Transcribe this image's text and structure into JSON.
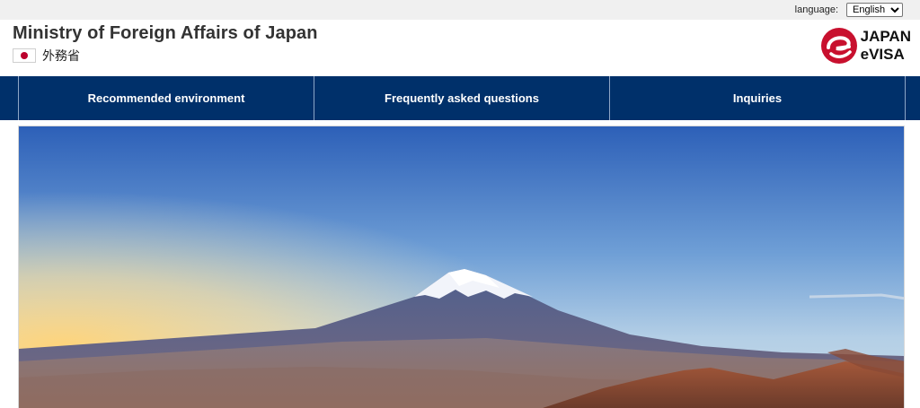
{
  "topbar": {
    "language_label": "language:",
    "language_options": [
      "English"
    ],
    "language_selected": "English"
  },
  "header": {
    "ministry_title": "Ministry of Foreign Affairs of Japan",
    "ministry_japanese": "外務省",
    "logo_line1": "JAPAN",
    "logo_line2": "eVISA",
    "logo_color": "#c8102e"
  },
  "nav": {
    "items": [
      {
        "label": "Recommended environment"
      },
      {
        "label": "Frequently asked questions"
      },
      {
        "label": "Inquiries"
      }
    ],
    "background": "#00306a"
  },
  "hero": {
    "image": "mount-fuji-landscape"
  }
}
